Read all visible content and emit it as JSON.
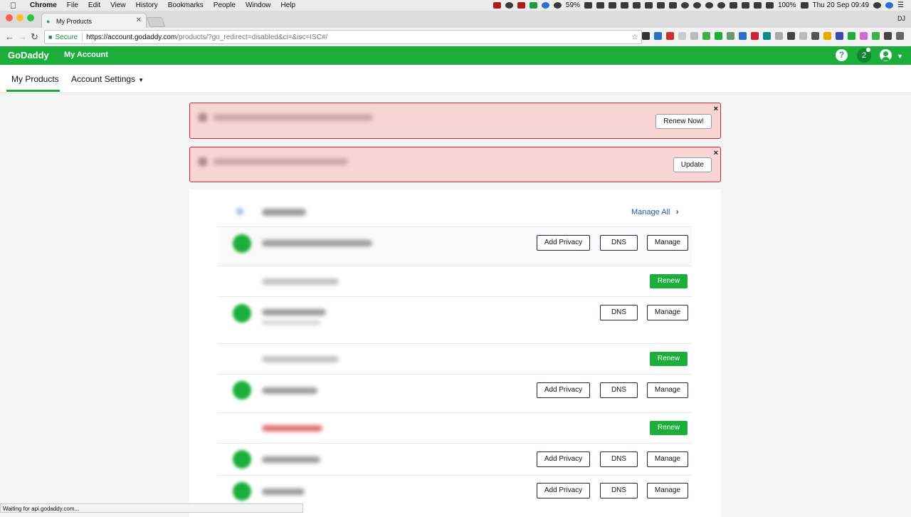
{
  "macos_menubar": {
    "app": "Chrome",
    "menus": [
      "File",
      "Edit",
      "View",
      "History",
      "Bookmarks",
      "People",
      "Window",
      "Help"
    ],
    "wifi_percent": "59%",
    "battery": "100%",
    "datetime": "Thu 20 Sep  09:49"
  },
  "browser": {
    "tab_title": "My Products",
    "url_secure_label": "Secure",
    "url_host": "https://account.godaddy.com",
    "url_path": "/products/?go_redirect=disabled&ci=&isc=ISC#/",
    "profile": "DJ",
    "status_text": "Waiting for api.godaddy.com..."
  },
  "header": {
    "logo": "GoDaddy",
    "title": "My Account",
    "help": "?",
    "notification_count": "2"
  },
  "subnav": {
    "products_tab": "My Products",
    "settings_tab": "Account Settings"
  },
  "alerts": {
    "renew_button": "Renew Now!",
    "update_button": "Update",
    "close": "×"
  },
  "products": {
    "manage_all": "Manage All",
    "add_privacy": "Add Privacy",
    "dns": "DNS",
    "manage": "Manage",
    "renew": "Renew"
  },
  "colors": {
    "brand_green": "#1bae3b",
    "alert_red": "#d9232f",
    "alert_bg": "#f8d6d6",
    "link_blue": "#1a5aa8"
  }
}
